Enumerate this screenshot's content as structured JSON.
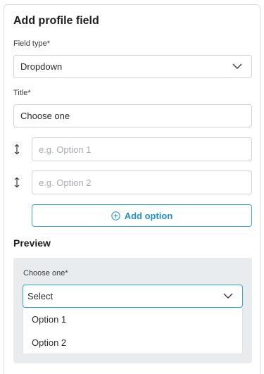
{
  "panel": {
    "title": "Add profile field"
  },
  "field_type": {
    "label": "Field type*",
    "value": "Dropdown"
  },
  "title_field": {
    "label": "Title*",
    "value": "Choose one"
  },
  "options": [
    {
      "placeholder": "e.g. Option 1"
    },
    {
      "placeholder": "e.g. Option 2"
    }
  ],
  "add_option": {
    "label": "Add option"
  },
  "preview": {
    "heading": "Preview",
    "label": "Choose one*",
    "select_value": "Select",
    "menu_items": [
      "Option 1",
      "Option 2"
    ]
  },
  "colors": {
    "accent": "#1f93c8",
    "accent_border": "#33a6d6",
    "preview_bg": "#e9ecef"
  },
  "icons": [
    "chevron-down-icon",
    "drag-handle-icon",
    "plus-circle-icon"
  ]
}
